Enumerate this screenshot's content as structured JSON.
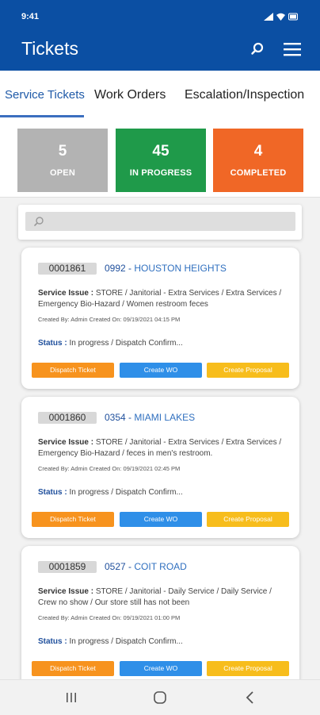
{
  "status_bar": {
    "time": "9:41"
  },
  "header": {
    "title": "Tickets",
    "icons": [
      "search-icon",
      "menu-icon"
    ]
  },
  "tabs": [
    {
      "label": "Service Tickets",
      "active": true
    },
    {
      "label": "Work Orders",
      "active": false
    },
    {
      "label": "Escalation/Inspection",
      "active": false
    }
  ],
  "stats": [
    {
      "value": "5",
      "label": "OPEN",
      "color": "#b3b3b3"
    },
    {
      "value": "45",
      "label": "IN PROGRESS",
      "color": "#1f9a4a"
    },
    {
      "value": "4",
      "label": "COMPLETED",
      "color": "#f06726"
    }
  ],
  "search": {
    "placeholder": ""
  },
  "tickets": [
    {
      "id": "0001861",
      "store_code": "0992",
      "separator": "-",
      "store_name": "HOUSTON HEIGHTS",
      "issue_label": "Service Issue :",
      "issue_text": "STORE / Janitorial - Extra Services / Extra Services / Emergency Bio-Hazard / Women restroom feces",
      "created": "Created By: Admin Created On: 09/19/2021 04:15 PM",
      "status_label": "Status :",
      "status_text": "In progress / Dispatch Confirm..."
    },
    {
      "id": "0001860",
      "store_code": "0354",
      "separator": "-",
      "store_name": "MIAMI LAKES",
      "issue_label": "Service Issue :",
      "issue_text": "STORE / Janitorial - Extra Services / Extra Services / Emergency Bio-Hazard / feces in men's restroom.",
      "created": "Created By: Admin Created On: 09/19/2021 02:45 PM",
      "status_label": "Status :",
      "status_text": "In progress / Dispatch Confirm..."
    },
    {
      "id": "0001859",
      "store_code": "0527",
      "separator": "-",
      "store_name": "COIT ROAD",
      "issue_label": "Service Issue :",
      "issue_text": "STORE / Janitorial - Daily Service / Daily Service / Crew no show / Our store still has not been",
      "created": "Created By: Admin Created On: 09/19/2021 01:00 PM",
      "status_label": "Status :",
      "status_text": "In progress / Dispatch Confirm..."
    }
  ],
  "actions": {
    "dispatch": {
      "label": "Dispatch Ticket",
      "color": "#f7931e"
    },
    "create_wo": {
      "label": "Create WO",
      "color": "#2f8fe8"
    },
    "create_proposal": {
      "label": "Create Proposal",
      "color": "#f7bd1c"
    }
  },
  "nav": [
    "recent-apps-icon",
    "home-icon",
    "back-icon"
  ]
}
